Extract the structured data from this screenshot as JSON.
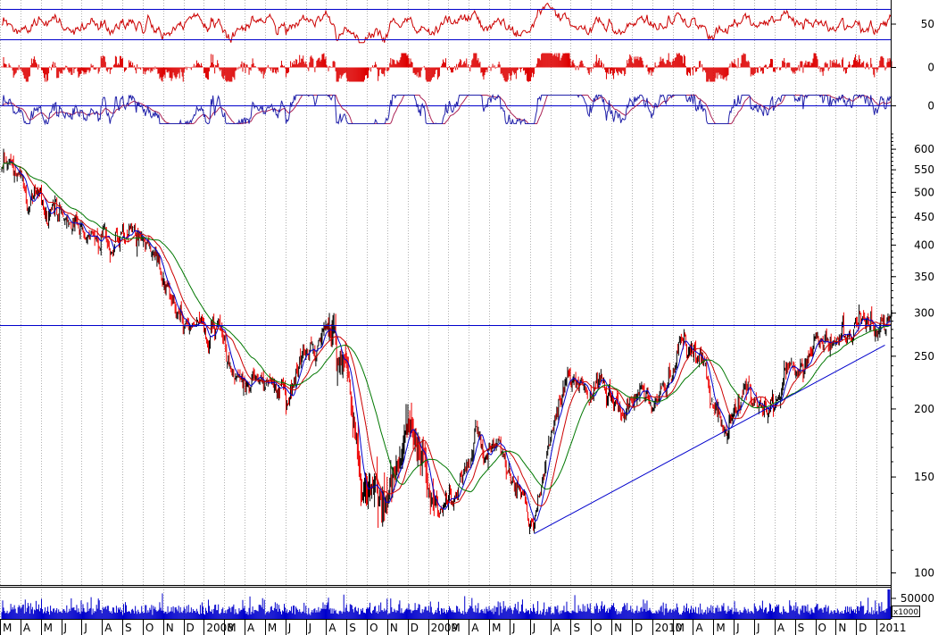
{
  "chart_data": [
    {
      "type": "line",
      "panel": "oscillator-1",
      "title": "",
      "ylabel": "",
      "tick_labels": [
        "50"
      ],
      "reference_levels": [
        70,
        30
      ],
      "series": [
        {
          "color": "#cc0000"
        }
      ]
    },
    {
      "type": "bar",
      "panel": "oscillator-2",
      "title": "",
      "ylabel": "",
      "tick_labels": [
        "0"
      ],
      "series": [
        {
          "color": "#dd0000"
        }
      ]
    },
    {
      "type": "line",
      "panel": "oscillator-3",
      "title": "",
      "ylabel": "",
      "tick_labels": [
        "0"
      ],
      "series": [
        {
          "color": "#2222aa"
        },
        {
          "color": "#aa2255"
        }
      ]
    },
    {
      "type": "candlestick",
      "panel": "price",
      "title": "",
      "ylabel": "",
      "yscale": "log",
      "ylim": [
        95,
        640
      ],
      "ytick_labels": [
        "600",
        "550",
        "500",
        "450",
        "400",
        "350",
        "300",
        "250",
        "200",
        "150",
        "100"
      ],
      "yticks": [
        600,
        550,
        500,
        450,
        400,
        350,
        300,
        250,
        200,
        150,
        100
      ],
      "x_month_labels": [
        "M",
        "A",
        "M",
        "J",
        "J",
        "A",
        "S",
        "O",
        "N",
        "D",
        "2008",
        "M",
        "A",
        "M",
        "J",
        "J",
        "A",
        "S",
        "O",
        "N",
        "D",
        "2009",
        "M",
        "A",
        "M",
        "J",
        "J",
        "A",
        "S",
        "O",
        "N",
        "D",
        "2010",
        "M",
        "A",
        "M",
        "J",
        "J",
        "A",
        "S",
        "O",
        "N",
        "D",
        "2011"
      ],
      "horizontal_line": 285,
      "trendline": {
        "start": {
          "month": "Jul 2009",
          "value": 118
        },
        "end": {
          "month": "Jan 2011",
          "value": 262
        }
      },
      "price_anchors": [
        {
          "month": "Mar 2007",
          "value": 540
        },
        {
          "month": "Apr 2007",
          "value": 520
        },
        {
          "month": "May 2007",
          "value": 515
        },
        {
          "month": "Jun 2007",
          "value": 470
        },
        {
          "month": "Jul 2007",
          "value": 425
        },
        {
          "month": "Aug 2007",
          "value": 410
        },
        {
          "month": "Sep 2007",
          "value": 390
        },
        {
          "month": "Oct 2007",
          "value": 420
        },
        {
          "month": "Nov 2007",
          "value": 400
        },
        {
          "month": "Dec 2007",
          "value": 330
        },
        {
          "month": "Jan 2008",
          "value": 300
        },
        {
          "month": "Feb 2008",
          "value": 300
        },
        {
          "month": "Mar 2008",
          "value": 240
        },
        {
          "month": "Apr 2008",
          "value": 225
        },
        {
          "month": "May 2008",
          "value": 225
        },
        {
          "month": "Jun 2008",
          "value": 215
        },
        {
          "month": "Jul 2008",
          "value": 250
        },
        {
          "month": "Aug 2008",
          "value": 270
        },
        {
          "month": "Sep 2008",
          "value": 250
        },
        {
          "month": "Oct 2008",
          "value": 150
        },
        {
          "month": "Nov 2008",
          "value": 140
        },
        {
          "month": "Dec 2008",
          "value": 160
        },
        {
          "month": "Jan 2009",
          "value": 180
        },
        {
          "month": "Feb 2009",
          "value": 130
        },
        {
          "month": "Mar 2009",
          "value": 140
        },
        {
          "month": "Apr 2009",
          "value": 170
        },
        {
          "month": "May 2009",
          "value": 160
        },
        {
          "month": "Jun 2009",
          "value": 145
        },
        {
          "month": "Jul 2009",
          "value": 120
        },
        {
          "month": "Aug 2009",
          "value": 175
        },
        {
          "month": "Sep 2009",
          "value": 220
        },
        {
          "month": "Oct 2009",
          "value": 230
        },
        {
          "month": "Nov 2009",
          "value": 205
        },
        {
          "month": "Dec 2009",
          "value": 200
        },
        {
          "month": "Jan 2010",
          "value": 205
        },
        {
          "month": "Feb 2010",
          "value": 220
        },
        {
          "month": "Mar 2010",
          "value": 250
        },
        {
          "month": "Apr 2010",
          "value": 240
        },
        {
          "month": "May 2010",
          "value": 195
        },
        {
          "month": "Jun 2010",
          "value": 200
        },
        {
          "month": "Jul 2010",
          "value": 210
        },
        {
          "month": "Aug 2010",
          "value": 215
        },
        {
          "month": "Sep 2010",
          "value": 240
        },
        {
          "month": "Oct 2010",
          "value": 270
        },
        {
          "month": "Nov 2010",
          "value": 280
        },
        {
          "month": "Dec 2010",
          "value": 275
        },
        {
          "month": "Jan 2011",
          "value": 290
        }
      ],
      "moving_averages": [
        {
          "color": "#0000cc"
        },
        {
          "color": "#cc0000"
        },
        {
          "color": "#007700"
        }
      ],
      "candle_colors": {
        "up": "#000000",
        "down": "#ee0000"
      }
    },
    {
      "type": "bar",
      "panel": "volume",
      "title": "",
      "ytick_labels": [
        "50000"
      ],
      "unit_label": "x1000",
      "series": [
        {
          "color": "#0000cc"
        }
      ]
    }
  ],
  "colors": {
    "grid": "#b0b0b0",
    "reference_line": "#0000cc",
    "axis": "#000000"
  }
}
